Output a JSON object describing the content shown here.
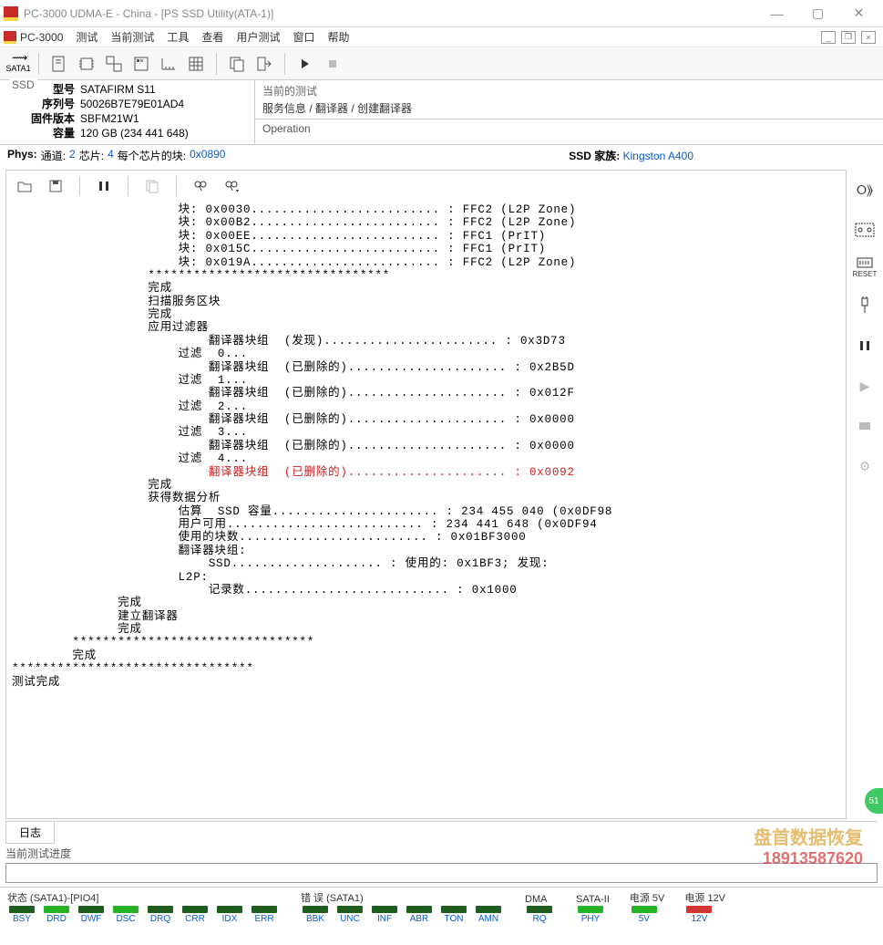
{
  "window": {
    "title": "PC-3000 UDMA-E - China - [PS SSD Utility(ATA-1)]"
  },
  "menu": {
    "app": "PC-3000",
    "items": [
      "测试",
      "当前测试",
      "工具",
      "查看",
      "用户测试",
      "窗口",
      "帮助"
    ]
  },
  "toolbar": {
    "sata_label": "SATA1"
  },
  "ssd": {
    "header": "SSD",
    "model_k": "型号",
    "model_v": "SATAFIRM   S11",
    "serial_k": "序列号",
    "serial_v": "50026B7E79E01AD4",
    "fw_k": "固件版本",
    "fw_v": "SBFM21W1",
    "cap_k": "容量",
    "cap_v": "120 GB (234 441 648)"
  },
  "current_test": {
    "label": "当前的测试",
    "path": "服务信息 / 翻译器 / 创建翻译器"
  },
  "operation_label": "Operation",
  "phys": {
    "label": "Phys:",
    "ch_k": "通道:",
    "ch_v": "2",
    "chip_k": "芯片:",
    "chip_v": "4",
    "blk_k": "每个芯片的块:",
    "blk_v": "0x0890",
    "fam_k": "SSD 家族:",
    "fam_v": "Kingston A400"
  },
  "console_lines": [
    {
      "pad": 22,
      "t": "块: 0x0030......................... : FFC2 (L2P Zone)"
    },
    {
      "pad": 22,
      "t": "块: 0x00B2......................... : FFC2 (L2P Zone)"
    },
    {
      "pad": 22,
      "t": "块: 0x00EE......................... : FFC1 (PrIT)"
    },
    {
      "pad": 22,
      "t": "块: 0x015C......................... : FFC1 (PrIT)"
    },
    {
      "pad": 22,
      "t": "块: 0x019A......................... : FFC2 (L2P Zone)"
    },
    {
      "pad": 18,
      "t": "********************************"
    },
    {
      "pad": 18,
      "t": "完成"
    },
    {
      "pad": 0,
      "t": ""
    },
    {
      "pad": 18,
      "t": "扫描服务区块"
    },
    {
      "pad": 18,
      "t": "完成"
    },
    {
      "pad": 0,
      "t": ""
    },
    {
      "pad": 18,
      "t": "应用过滤器"
    },
    {
      "pad": 26,
      "t": "翻译器块组  (发现)....................... : 0x3D73"
    },
    {
      "pad": 0,
      "t": ""
    },
    {
      "pad": 22,
      "t": "过滤  0..."
    },
    {
      "pad": 26,
      "t": "翻译器块组  (已删除的)..................... : 0x2B5D"
    },
    {
      "pad": 0,
      "t": ""
    },
    {
      "pad": 22,
      "t": "过滤  1..."
    },
    {
      "pad": 26,
      "t": "翻译器块组  (已删除的)..................... : 0x012F"
    },
    {
      "pad": 0,
      "t": ""
    },
    {
      "pad": 22,
      "t": "过滤  2..."
    },
    {
      "pad": 26,
      "t": "翻译器块组  (已删除的)..................... : 0x0000"
    },
    {
      "pad": 0,
      "t": ""
    },
    {
      "pad": 22,
      "t": "过滤  3..."
    },
    {
      "pad": 26,
      "t": "翻译器块组  (已删除的)..................... : 0x0000"
    },
    {
      "pad": 0,
      "t": ""
    },
    {
      "pad": 22,
      "t": "过滤  4..."
    },
    {
      "pad": 26,
      "t": "翻译器块组  (已删除的)..................... : 0x0092",
      "cls": "red"
    },
    {
      "pad": 18,
      "t": "完成"
    },
    {
      "pad": 0,
      "t": ""
    },
    {
      "pad": 18,
      "t": "获得数据分析"
    },
    {
      "pad": 22,
      "t": "估算  SSD 容量...................... : 234 455 040 (0x0DF98"
    },
    {
      "pad": 22,
      "t": "用户可用.......................... : 234 441 648 (0x0DF94"
    },
    {
      "pad": 22,
      "t": "使用的块数......................... : 0x01BF3000"
    },
    {
      "pad": 0,
      "t": ""
    },
    {
      "pad": 22,
      "t": "翻译器块组:"
    },
    {
      "pad": 26,
      "t": "SSD.................... : 使用的: 0x1BF3; 发现:"
    },
    {
      "pad": 0,
      "t": ""
    },
    {
      "pad": 22,
      "t": "L2P:"
    },
    {
      "pad": 26,
      "t": "记录数........................... : 0x1000"
    },
    {
      "pad": 14,
      "t": "完成"
    },
    {
      "pad": 0,
      "t": ""
    },
    {
      "pad": 14,
      "t": "建立翻译器"
    },
    {
      "pad": 14,
      "t": "完成"
    },
    {
      "pad": 8,
      "t": "********************************"
    },
    {
      "pad": 8,
      "t": "完成"
    },
    {
      "pad": 0,
      "t": "********************************"
    },
    {
      "pad": 0,
      "t": "测试完成"
    }
  ],
  "tabs": {
    "log": "日志"
  },
  "progress_label": "当前测试进度",
  "status": {
    "g1_hdr": "状态 (SATA1)-[PIO4]",
    "g1": [
      "BSY",
      "DRD",
      "DWF",
      "DSC",
      "DRQ",
      "CRR",
      "IDX",
      "ERR"
    ],
    "g1_led": [
      "dark",
      "green",
      "dark",
      "green",
      "dark",
      "dark",
      "dark",
      "dark"
    ],
    "g2_hdr": "错 误 (SATA1)",
    "g2": [
      "BBK",
      "UNC",
      "INF",
      "ABR",
      "TON",
      "AMN"
    ],
    "g2_led": [
      "dark",
      "dark",
      "dark",
      "dark",
      "dark",
      "dark"
    ],
    "g3_hdr": "DMA",
    "g3": [
      "RQ"
    ],
    "g3_led": [
      "dark"
    ],
    "g4_hdr": "SATA-II",
    "g4": [
      "PHY"
    ],
    "g4_led": [
      "green"
    ],
    "g5_hdr": "电源 5V",
    "g5": [
      "5V"
    ],
    "g5_led": [
      "green"
    ],
    "g6_hdr": "电源 12V",
    "g6": [
      "12V"
    ],
    "g6_led": [
      "red"
    ]
  },
  "side": {
    "reset": "RESET"
  },
  "watermark": {
    "l1": "盘首数据恢复",
    "l2": "18913587620"
  },
  "badge": "51"
}
